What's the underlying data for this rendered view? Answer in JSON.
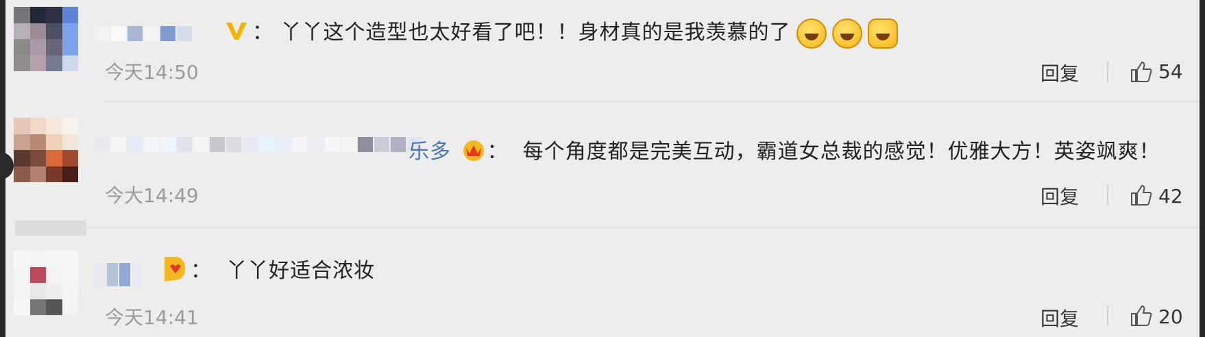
{
  "comments": [
    {
      "user_tag": "V",
      "sep": "：",
      "text": "丫丫这个造型也太好看了吧！！身材真的是我羡慕的了",
      "emojis": [
        "laugh-cry-emoji",
        "laugh-cry-emoji",
        "laugh-cry-emoji"
      ],
      "time": "今天14:50",
      "reply": "回复",
      "likes": "54"
    },
    {
      "user_tag": "乐多",
      "sep": "：",
      "text": "每个角度都是完美互动，霸道女总裁的感觉！优雅大方！英姿飒爽！",
      "time": "今大14:49",
      "reply": "回复",
      "likes": "42"
    },
    {
      "user_tag": "",
      "sep": "：",
      "text": "丫丫好适合浓妆",
      "time": "今天14:41",
      "reply": "回复",
      "likes": "20"
    }
  ],
  "colors": {
    "background": "#ededed",
    "name_link": "#4a76b8",
    "time": "#9a9a9a",
    "vip_gold": "#f1b400"
  },
  "icons": [
    "thumbs-up-icon",
    "vip-badge-icon",
    "crown-badge-icon",
    "fan-badge-icon"
  ]
}
